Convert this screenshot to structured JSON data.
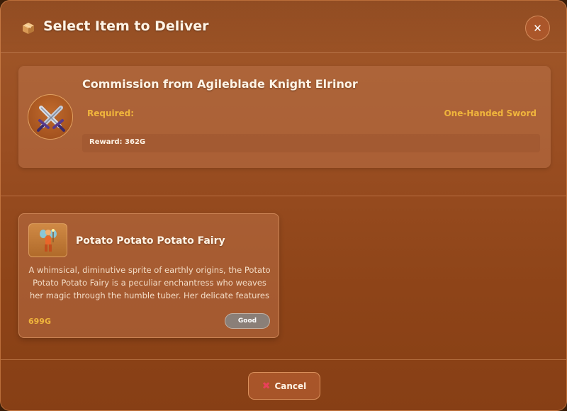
{
  "header": {
    "title": "Select Item to Deliver",
    "icon": "package-icon",
    "close_label": "✕"
  },
  "commission": {
    "title": "Commission from Agileblade Knight Elrinor",
    "icon": "crossed-swords-icon",
    "required_label": "Required:",
    "required_value": "One-Handed Sword",
    "reward": "Reward: 362G"
  },
  "items": [
    {
      "name": "Potato Potato Potato Fairy",
      "icon": "fairy-icon",
      "description": "A whimsical, diminutive sprite of earthly origins, the Potato Potato Potato Fairy is a peculiar enchantress who weaves her magic through the humble tuber. Her delicate features and..",
      "price": "699G",
      "quality": "Good"
    }
  ],
  "footer": {
    "cancel_icon": "✖",
    "cancel_label": "Cancel"
  },
  "colors": {
    "accent_gold": "#f0b53c",
    "cancel_red": "#e8405a",
    "panel_brown": "#9a4e22"
  }
}
